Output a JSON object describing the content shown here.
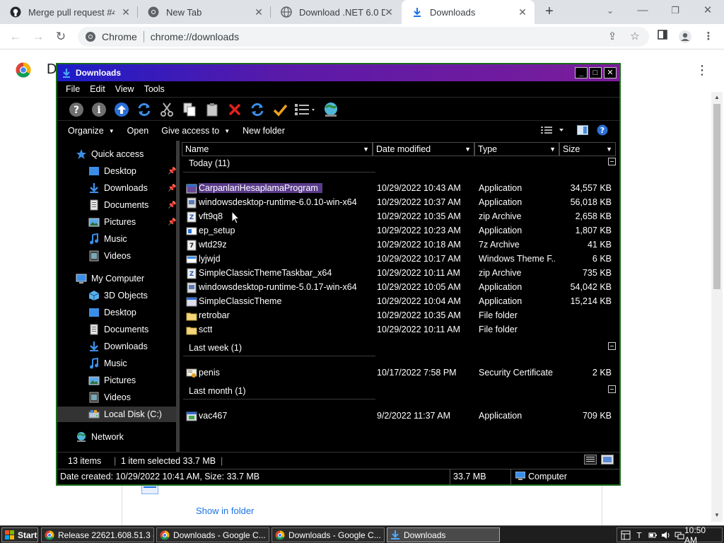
{
  "browser": {
    "tabs": [
      {
        "title": "Merge pull request #45",
        "icon": "github-icon"
      },
      {
        "title": "New Tab",
        "icon": "chrome-icon"
      },
      {
        "title": "Download .NET 6.0 De",
        "icon": "globe-icon"
      },
      {
        "title": "Downloads",
        "icon": "download-icon",
        "active": true
      }
    ],
    "omnibox_chip": "Chrome",
    "url": "chrome://downloads",
    "page_title_fragment": "D",
    "show_in_folder": "Show in folder"
  },
  "explorer": {
    "title": "Downloads",
    "menu": [
      "File",
      "Edit",
      "View",
      "Tools"
    ],
    "commands": {
      "organize": "Organize",
      "open": "Open",
      "give_access": "Give access to",
      "new_folder": "New folder"
    },
    "nav": {
      "quick_access": "Quick access",
      "quick_items": [
        "Desktop",
        "Downloads",
        "Documents",
        "Pictures",
        "Music",
        "Videos"
      ],
      "my_computer": "My Computer",
      "computer_items": [
        "3D Objects",
        "Desktop",
        "Documents",
        "Downloads",
        "Music",
        "Pictures",
        "Videos",
        "Local Disk (C:)"
      ],
      "network": "Network"
    },
    "columns": {
      "name": "Name",
      "date": "Date modified",
      "type": "Type",
      "size": "Size"
    },
    "groups": {
      "today": "Today (11)",
      "last_week": "Last week (1)",
      "last_month": "Last month (1)"
    },
    "files": [
      {
        "name": "CarpanlariHesaplamaProgram",
        "date": "10/29/2022 10:43 AM",
        "type": "Application",
        "size": "34,557 KB",
        "icon": "application-icon",
        "selected": true
      },
      {
        "name": "windowsdesktop-runtime-6.0.10-win-x64",
        "date": "10/29/2022 10:37 AM",
        "type": "Application",
        "size": "56,018 KB",
        "icon": "installer-icon"
      },
      {
        "name": "vft9q8",
        "date": "10/29/2022 10:35 AM",
        "type": "zip Archive",
        "size": "2,658 KB",
        "icon": "zip-archive-icon"
      },
      {
        "name": "ep_setup",
        "date": "10/29/2022 10:23 AM",
        "type": "Application",
        "size": "1,807 KB",
        "icon": "setup-icon"
      },
      {
        "name": "wtd29z",
        "date": "10/29/2022 10:18 AM",
        "type": "7z Archive",
        "size": "41 KB",
        "icon": "7z-archive-icon"
      },
      {
        "name": "lyjwjd",
        "date": "10/29/2022 10:17 AM",
        "type": "Windows Theme F...",
        "size": "6 KB",
        "icon": "theme-file-icon"
      },
      {
        "name": "SimpleClassicThemeTaskbar_x64",
        "date": "10/29/2022 10:11 AM",
        "type": "zip Archive",
        "size": "735 KB",
        "icon": "zip-archive-icon"
      },
      {
        "name": "windowsdesktop-runtime-5.0.17-win-x64",
        "date": "10/29/2022 10:05 AM",
        "type": "Application",
        "size": "54,042 KB",
        "icon": "installer-icon"
      },
      {
        "name": "SimpleClassicTheme",
        "date": "10/29/2022 10:04 AM",
        "type": "Application",
        "size": "15,214 KB",
        "icon": "application-icon"
      },
      {
        "name": "retrobar",
        "date": "10/29/2022 10:35 AM",
        "type": "File folder",
        "size": "",
        "icon": "folder-icon"
      },
      {
        "name": "sctt",
        "date": "10/29/2022 10:11 AM",
        "type": "File folder",
        "size": "",
        "icon": "folder-icon"
      }
    ],
    "last_week_files": [
      {
        "name": "penis",
        "date": "10/17/2022 7:58 PM",
        "type": "Security Certificate",
        "size": "2 KB",
        "icon": "certificate-icon"
      }
    ],
    "last_month_files": [
      {
        "name": "vac467",
        "date": "9/2/2022 11:37 AM",
        "type": "Application",
        "size": "709 KB",
        "icon": "application-icon"
      }
    ],
    "status": {
      "count": "13 items",
      "selected": "1 item selected  33.7 MB",
      "details": "Date created: 10/29/2022 10:41 AM, Size: 33.7 MB",
      "size": "33.7 MB",
      "location": "Computer"
    }
  },
  "taskbar": {
    "start": "Start",
    "tasks": [
      {
        "label": "Release 22621.608.51.3 -...",
        "icon": "chrome-icon"
      },
      {
        "label": "Downloads - Google C...",
        "icon": "chrome-icon"
      },
      {
        "label": "Downloads - Google C...",
        "icon": "chrome-icon"
      },
      {
        "label": "Downloads",
        "icon": "download-folder-icon",
        "active": true
      }
    ],
    "clock": "10:50 AM"
  }
}
